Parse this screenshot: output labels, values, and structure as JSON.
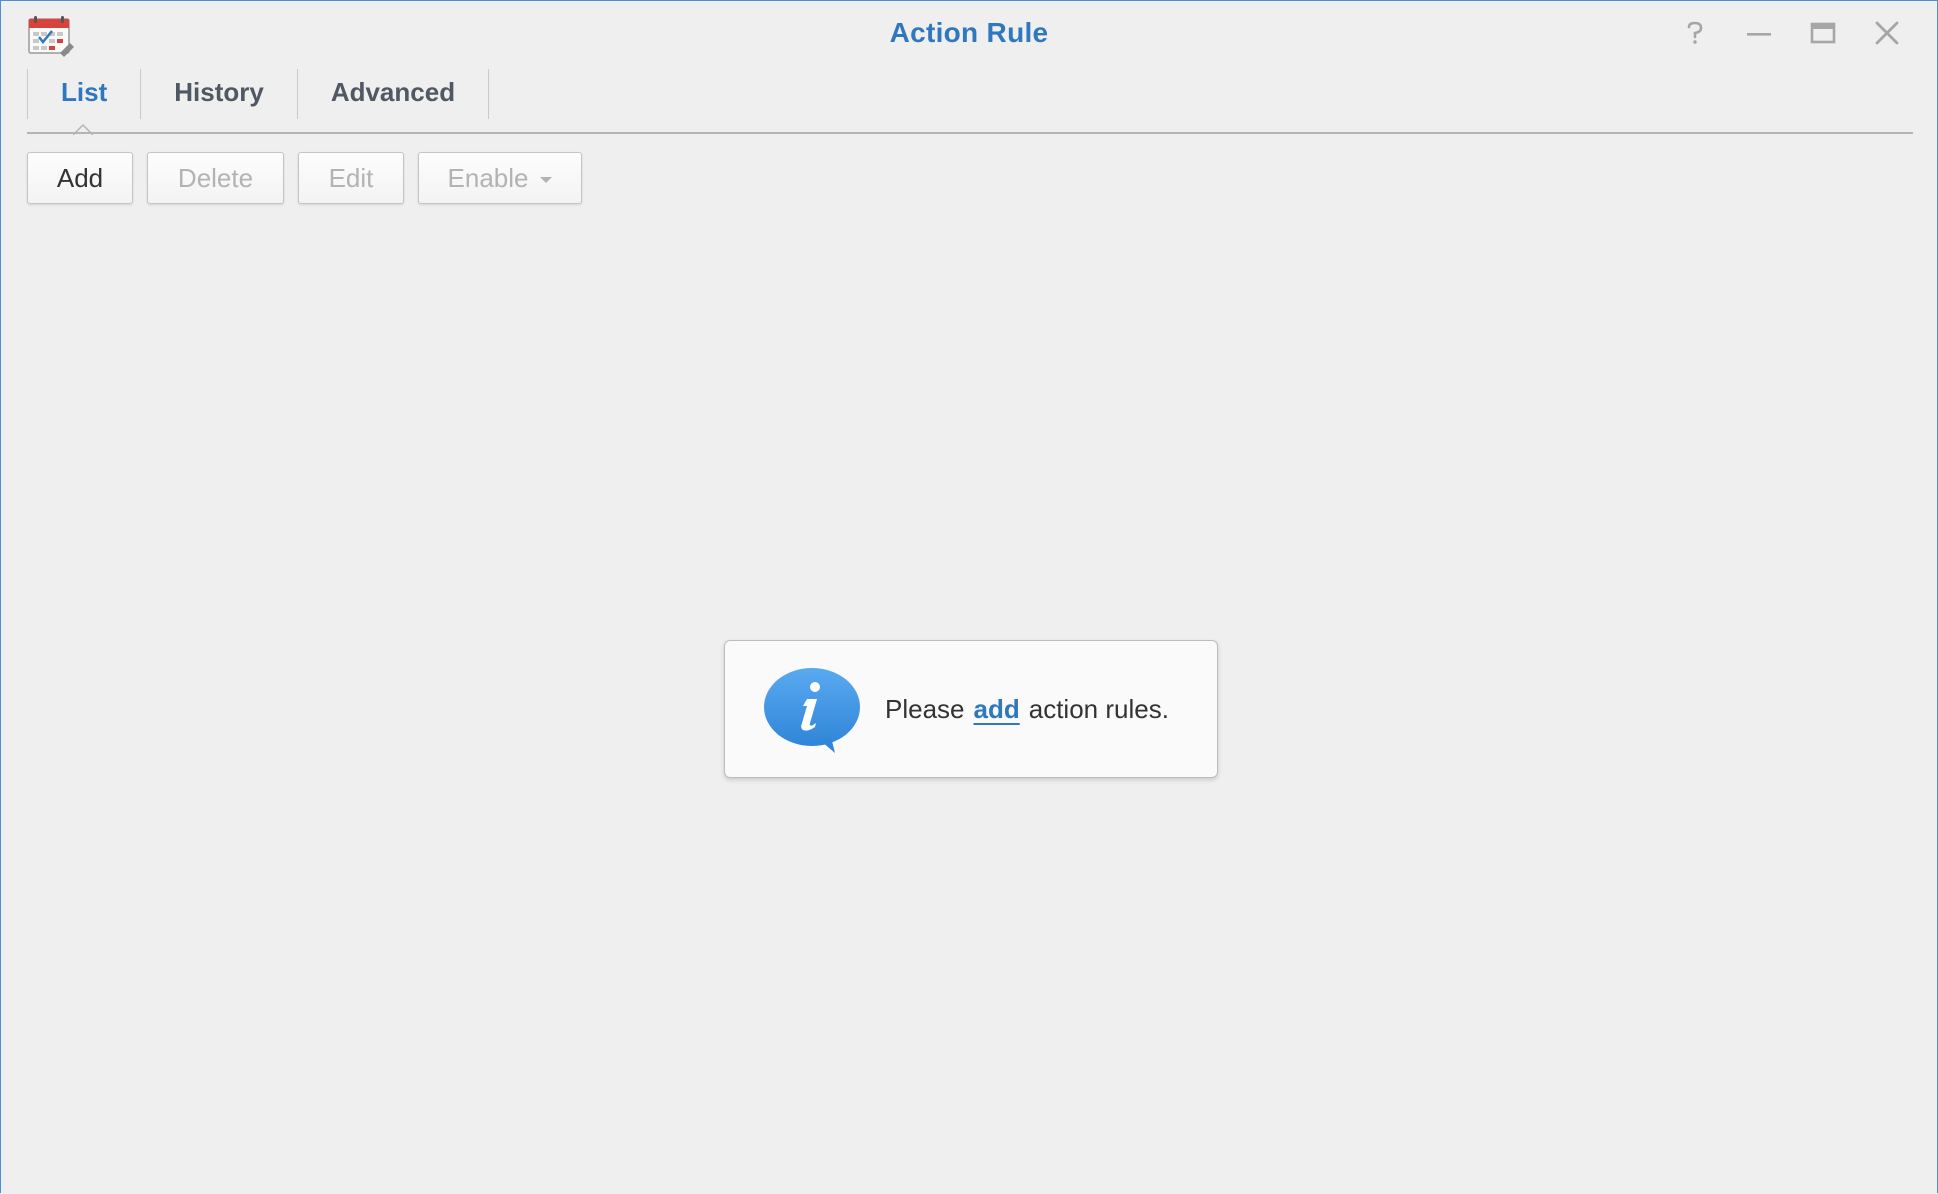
{
  "window": {
    "title": "Action Rule",
    "accent_color": "#2f78c0",
    "controls": [
      "help-icon",
      "minimize-icon",
      "maximize-icon",
      "close-icon"
    ]
  },
  "tabs": [
    {
      "label": "List",
      "active": true
    },
    {
      "label": "History",
      "active": false
    },
    {
      "label": "Advanced",
      "active": false
    }
  ],
  "toolbar": {
    "add_label": "Add",
    "delete_label": "Delete",
    "edit_label": "Edit",
    "enable_label": "Enable"
  },
  "empty_state": {
    "prefix": "Please",
    "link": "add",
    "suffix": "action rules.",
    "icon": "info-bubble-icon"
  }
}
